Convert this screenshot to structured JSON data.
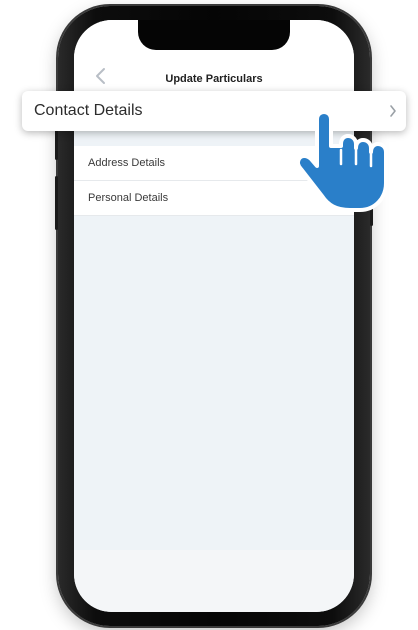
{
  "header": {
    "title": "Update Particulars",
    "back_icon": "chevron-left-icon"
  },
  "highlight": {
    "label": "Contact Details",
    "chevron_icon": "chevron-right-icon",
    "pointer_icon": "pointing-hand-icon"
  },
  "list": {
    "items": [
      {
        "label": "Address Details"
      },
      {
        "label": "Personal Details"
      }
    ]
  },
  "colors": {
    "hand_fill": "#2a7fc9",
    "screen_background": "#eef3f7"
  }
}
